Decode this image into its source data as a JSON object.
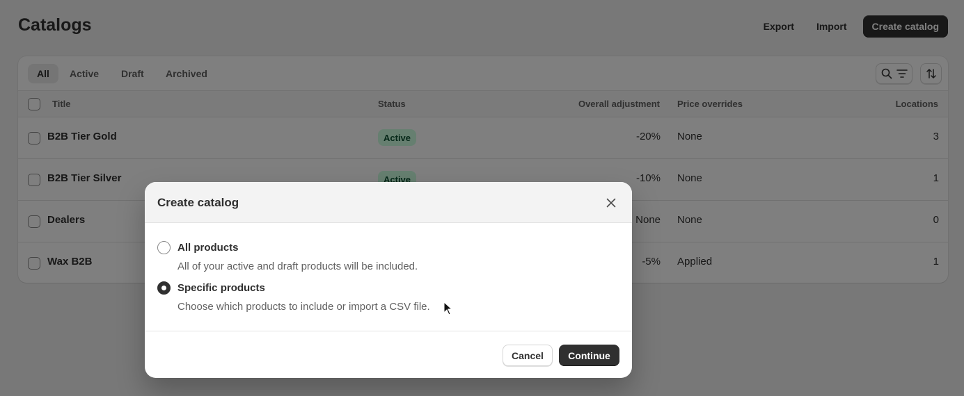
{
  "page": {
    "title": "Catalogs",
    "export_label": "Export",
    "import_label": "Import",
    "create_label": "Create catalog"
  },
  "tabs": [
    {
      "label": "All",
      "selected": true
    },
    {
      "label": "Active",
      "selected": false
    },
    {
      "label": "Draft",
      "selected": false
    },
    {
      "label": "Archived",
      "selected": false
    }
  ],
  "toolbar_icons": [
    "search-icon",
    "filter-icon",
    "sort-icon"
  ],
  "table": {
    "columns": [
      "Title",
      "Status",
      "Overall adjustment",
      "Price overrides",
      "Locations"
    ],
    "rows": [
      {
        "title": "B2B Tier Gold",
        "status": "Active",
        "adjustment": "-20%",
        "overrides": "None",
        "locations": "3"
      },
      {
        "title": "B2B Tier Silver",
        "status": "Active",
        "adjustment": "-10%",
        "overrides": "None",
        "locations": "1"
      },
      {
        "title": "Dealers",
        "status": "",
        "adjustment": "None",
        "overrides": "None",
        "locations": "0"
      },
      {
        "title": "Wax B2B",
        "status": "",
        "adjustment": "-5%",
        "overrides": "Applied",
        "locations": "1"
      }
    ]
  },
  "modal": {
    "title": "Create catalog",
    "options": [
      {
        "label": "All products",
        "help": "All of your active and draft products will be included.",
        "checked": false
      },
      {
        "label": "Specific products",
        "help": "Choose which products to include or import a CSV file.",
        "checked": true
      }
    ],
    "cancel_label": "Cancel",
    "continue_label": "Continue"
  },
  "colors": {
    "primary": "#303030",
    "badge_bg": "#cdfee1",
    "badge_text": "#0c5132",
    "background": "#f1f1f1"
  }
}
